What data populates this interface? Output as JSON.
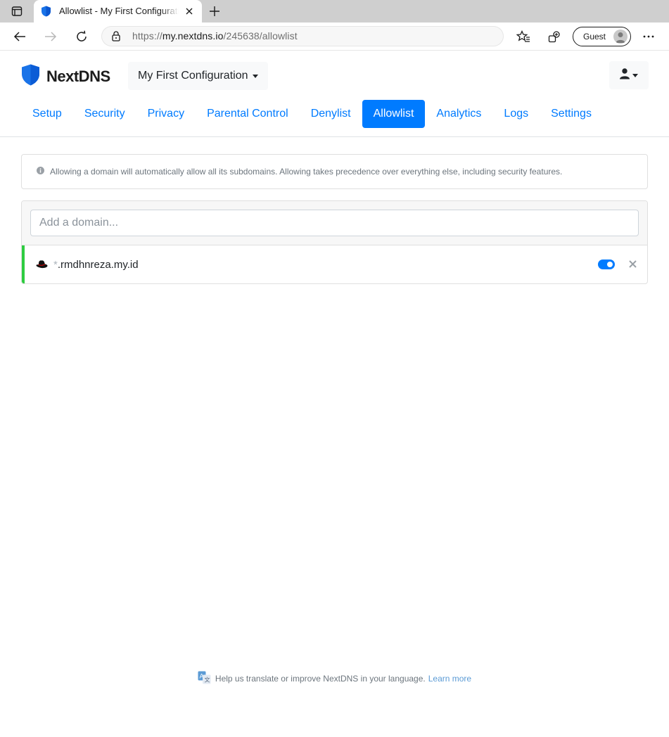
{
  "browser": {
    "tab_title": "Allowlist - My First Configuration",
    "url_prefix": "https://",
    "url_host": "my.nextdns.io",
    "url_path": "/245638/allowlist",
    "profile_label": "Guest"
  },
  "header": {
    "brand": "NextDNS",
    "configuration": "My First Configuration"
  },
  "nav": {
    "items": [
      {
        "label": "Setup"
      },
      {
        "label": "Security"
      },
      {
        "label": "Privacy"
      },
      {
        "label": "Parental Control"
      },
      {
        "label": "Denylist"
      },
      {
        "label": "Allowlist",
        "active": true
      },
      {
        "label": "Analytics"
      },
      {
        "label": "Logs"
      },
      {
        "label": "Settings"
      }
    ]
  },
  "notice": {
    "text": "Allowing a domain will automatically allow all its subdomains. Allowing takes precedence over everything else, including security features."
  },
  "allowlist": {
    "input_placeholder": "Add a domain...",
    "entries": [
      {
        "wildcard": "*",
        "domain": ".rmdhnreza.my.id",
        "enabled": true
      }
    ]
  },
  "footer": {
    "text": "Help us translate or improve NextDNS in your language.",
    "link": "Learn more"
  },
  "colors": {
    "accent": "#007bff",
    "entry_indicator": "#2ecc40"
  }
}
